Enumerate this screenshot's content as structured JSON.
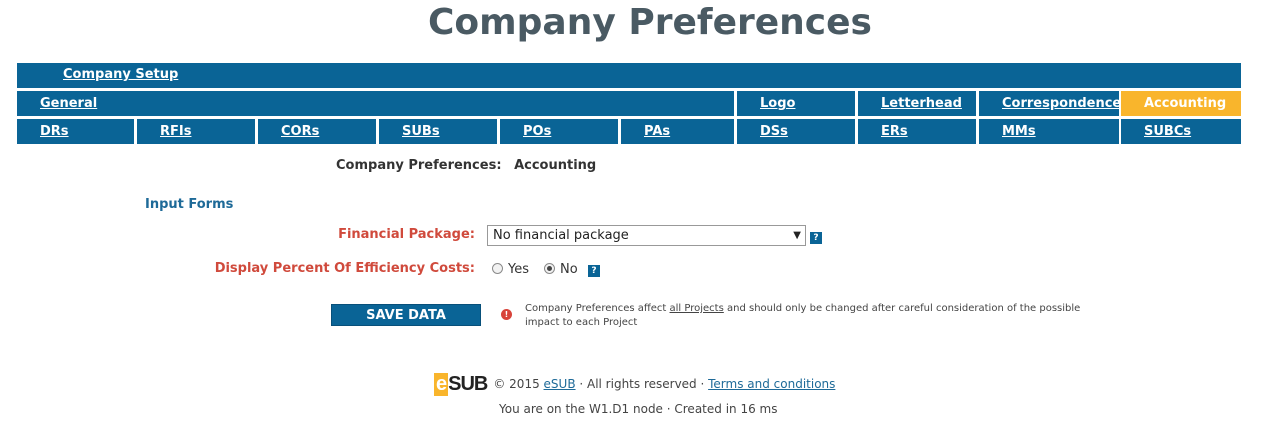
{
  "page_title": "Company Preferences",
  "nav": {
    "setup_label": "Company Setup",
    "row2": [
      "General",
      "Logo",
      "Letterhead",
      "Correspondence",
      "Accounting"
    ],
    "row3": [
      "DRs",
      "RFIs",
      "CORs",
      "SUBs",
      "POs",
      "PAs",
      "DSs",
      "ERs",
      "MMs",
      "SUBCs"
    ],
    "active": "Accounting",
    "active_color": "#f9b52c",
    "nav_color": "#0a6496"
  },
  "section": {
    "label": "Company Preferences:",
    "value": "Accounting"
  },
  "input_forms_label": "Input Forms",
  "form": {
    "financial_package_label": "Financial Package:",
    "financial_package_value": "No financial package",
    "efficiency_label": "Display Percent Of Efficiency Costs:",
    "yes_label": "Yes",
    "no_label": "No",
    "efficiency_selected": "No",
    "help_glyph": "?"
  },
  "save_button_label": "SAVE DATA",
  "warning": {
    "text_before": "Company Preferences affect ",
    "link_text": "all Projects",
    "text_after": " and should only be changed after careful consideration of the possible impact to each Project",
    "icon": "!"
  },
  "footer": {
    "logo_e": "e",
    "logo_rest": "SUB",
    "copyright": "© 2015 ",
    "brand_link": "eSUB",
    "rights": " · All rights reserved · ",
    "terms_link": "Terms and conditions",
    "node_line": "You are on the W1.D1 node ·  Created in 16 ms"
  }
}
